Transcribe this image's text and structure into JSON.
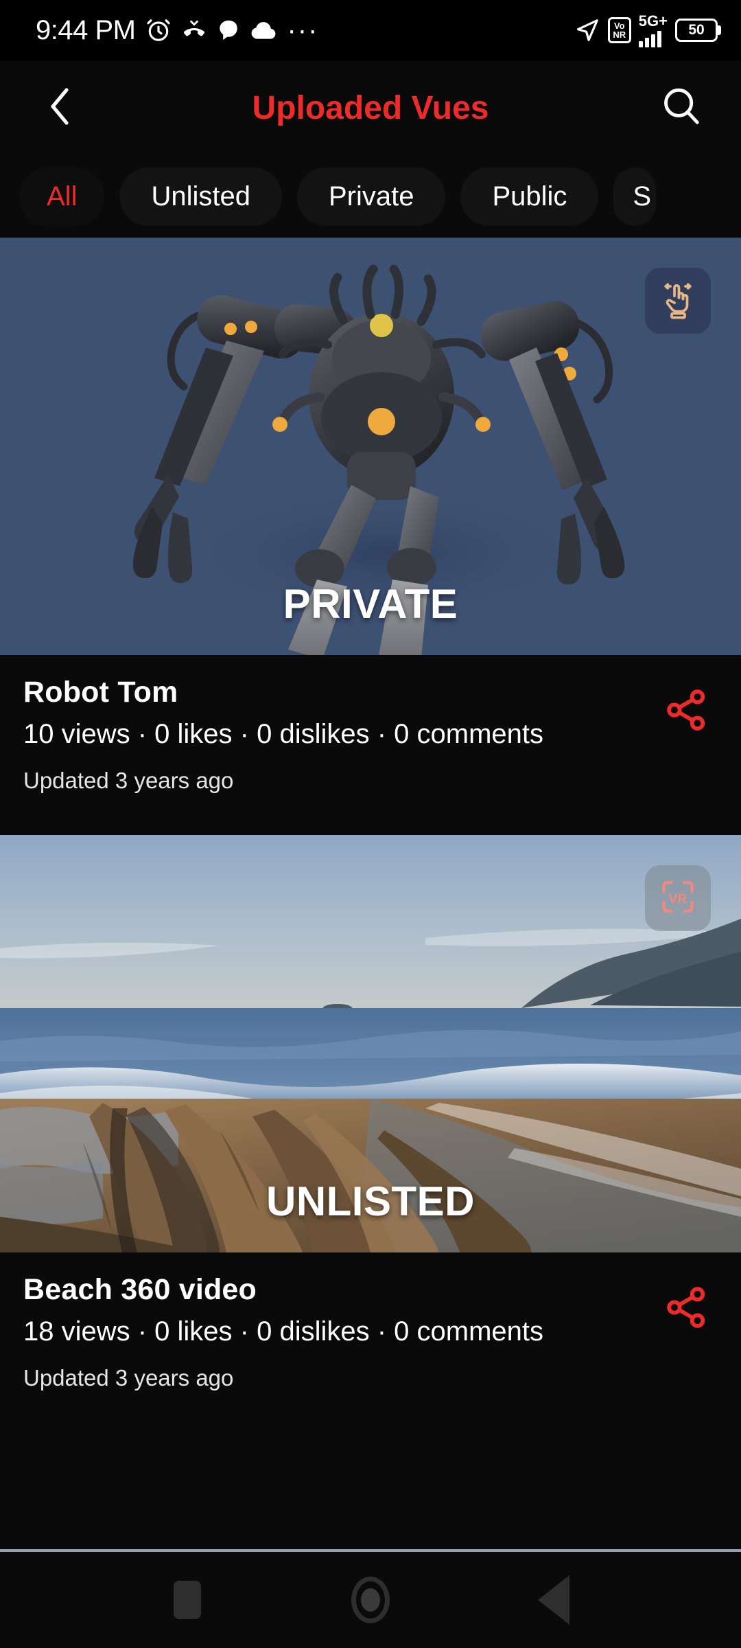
{
  "status_bar": {
    "time": "9:44 PM",
    "icons_left": [
      "alarm-icon",
      "missed-call-icon",
      "message-icon",
      "cloud-icon",
      "more-dots-icon"
    ],
    "location_icon": "location-arrow-icon",
    "vonr_line1": "Vo",
    "vonr_line2": "NR",
    "network": "5G+",
    "battery_level": "50"
  },
  "header": {
    "title": "Uploaded Vues",
    "title_color": "#EE2B2B",
    "back_icon": "chevron-left-icon",
    "search_icon": "search-icon"
  },
  "filters": {
    "chips": [
      {
        "label": "All",
        "active": true
      },
      {
        "label": "Unlisted",
        "active": false
      },
      {
        "label": "Private",
        "active": false
      },
      {
        "label": "Public",
        "active": false
      },
      {
        "label": "S",
        "active": false
      }
    ]
  },
  "videos": [
    {
      "title": "Robot Tom",
      "stats": "10 views · 0 likes · 0 dislikes · 0 comments",
      "updated": "Updated 3 years ago",
      "privacy_label": "PRIVATE",
      "badge_icon": "drag-hand-icon",
      "badge_color": "#E8B887",
      "thumb_bg": "#3D5173",
      "share_icon": "share-icon",
      "share_color": "#EE2B2B"
    },
    {
      "title": "Beach 360 video",
      "stats": "18 views · 0 likes · 0 dislikes · 0 comments",
      "updated": "Updated 3 years ago",
      "privacy_label": "UNLISTED",
      "badge_icon": "vr-icon",
      "badge_text": "VR",
      "badge_color": "#F08A7E",
      "thumb_bg": "#8FA4BC",
      "share_icon": "share-icon",
      "share_color": "#EE2B2B"
    }
  ],
  "nav_bar": {
    "recents_icon": "square-icon",
    "home_icon": "circle-icon",
    "back_icon": "triangle-back-icon"
  }
}
